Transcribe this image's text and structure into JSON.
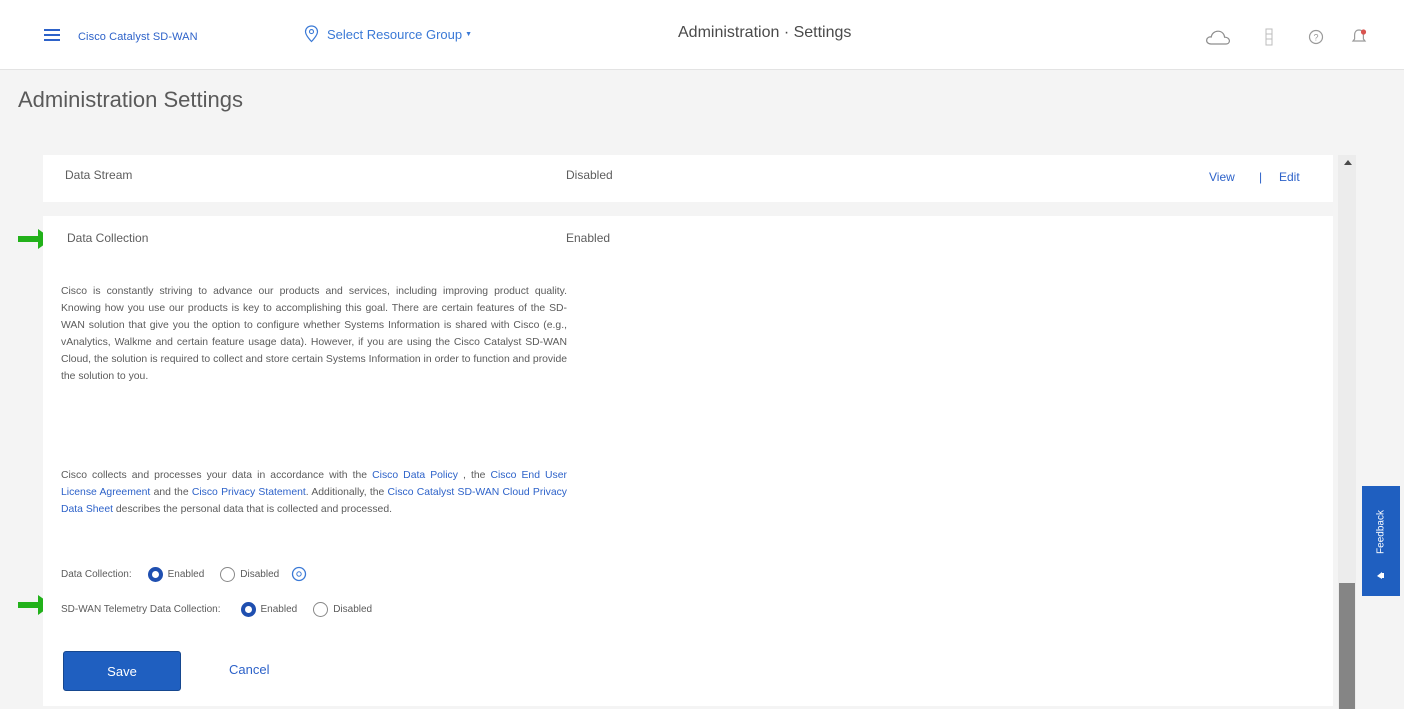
{
  "header": {
    "brand": "Cisco Catalyst SD-WAN",
    "resource_group": "Select Resource Group",
    "title": "Administration · Settings"
  },
  "page": {
    "title": "Administration Settings"
  },
  "data_stream": {
    "label": "Data Stream",
    "status": "Disabled",
    "view_label": "View",
    "separator": "|",
    "edit_label": "Edit"
  },
  "data_collection": {
    "label": "Data Collection",
    "status": "Enabled",
    "paragraph1": "Cisco is constantly striving to advance our products and services, including improving product quality. Knowing how you use our products is key to accomplishing this goal. There are certain features of the SD-WAN solution that give you the option to configure whether Systems Information is shared with Cisco (e.g., vAnalytics, Walkme and certain feature usage data). However, if you are using the Cisco Catalyst SD-WAN Cloud, the solution is required to collect and store certain Systems Information in order to function and provide the solution to you.",
    "p2_text1": "Cisco collects and processes your data in accordance with the ",
    "p2_link1": "Cisco Data Policy",
    "p2_text2": " , the ",
    "p2_link2": "Cisco End User License Agreement",
    "p2_text3": " and the ",
    "p2_link3": "Cisco Privacy Statement",
    "p2_text4": ". Additionally, the ",
    "p2_link4": "Cisco Catalyst SD-WAN Cloud Privacy Data Sheet",
    "p2_text5": " describes the personal data that is collected and processed.",
    "option1": {
      "label": "Data Collection:",
      "enabled": "Enabled",
      "disabled": "Disabled",
      "selected": "Enabled"
    },
    "option2": {
      "label": "SD-WAN Telemetry Data Collection:",
      "enabled": "Enabled",
      "disabled": "Disabled",
      "selected": "Enabled"
    },
    "save_label": "Save",
    "cancel_label": "Cancel"
  },
  "feedback": {
    "label": "Feedback"
  },
  "icons": {
    "menu": "hamburger-menu-icon",
    "resource_group": "location-pin-icon",
    "cloud": "cloud-icon",
    "tasks": "tasks-icon",
    "help": "help-icon",
    "notifications": "bell-icon",
    "info": "info-icon",
    "arrow": "green-arrow-icon"
  },
  "colors": {
    "accent": "#1f5fc0",
    "link": "#2d62c9",
    "arrow": "#22b11a",
    "bell": "#d9534f"
  }
}
